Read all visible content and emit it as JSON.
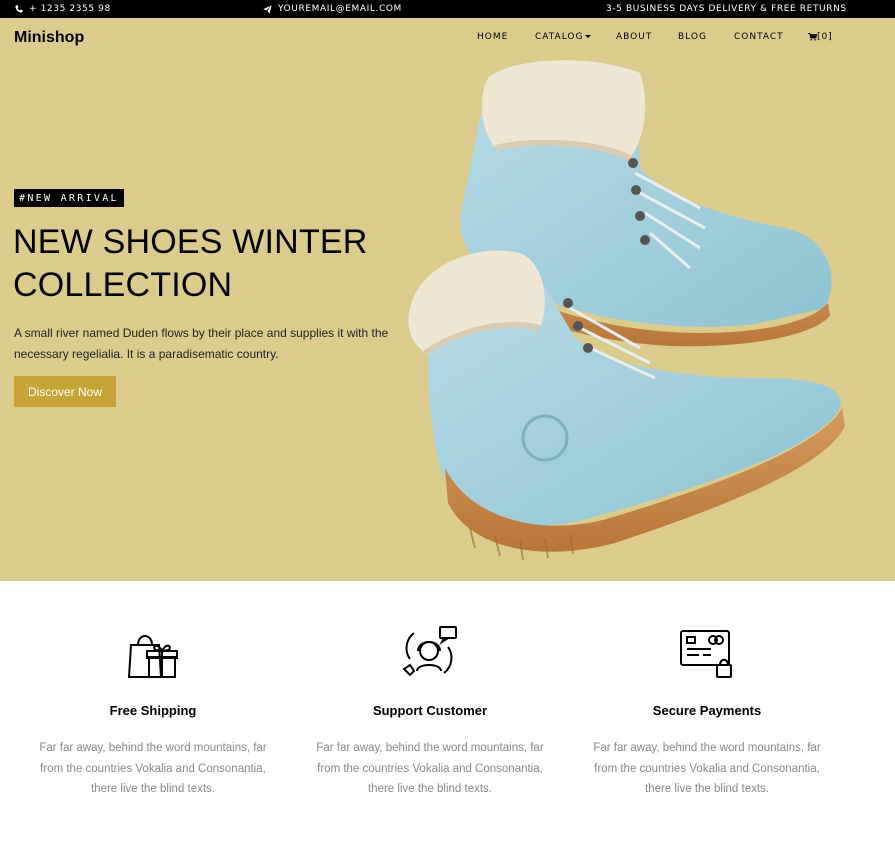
{
  "topbar": {
    "phone": "+ 1235 2355 98",
    "email": "YOUREMAIL@EMAIL.COM",
    "delivery": "3-5 BUSINESS DAYS DELIVERY & FREE RETURNS",
    "phone_icon": "phone-icon",
    "email_icon": "paper-plane-icon"
  },
  "header": {
    "logo": "Minishop",
    "nav": {
      "home": "HOME",
      "catalog": "CATALOG",
      "about": "ABOUT",
      "blog": "BLOG",
      "contact": "CONTACT",
      "cart": "[0]"
    }
  },
  "hero": {
    "badge": "#NEW ARRIVAL",
    "title_line1": "NEW SHOES WINTER",
    "title_line2": "COLLECTION",
    "description": "A small river named Duden flows by their place and supplies it with the necessary regelialia. It is a paradisematic country.",
    "cta": "Discover Now",
    "image": "blue-winter-boots",
    "bg_color": "#dbcc8d",
    "accent_color": "#c6a536"
  },
  "features": [
    {
      "icon": "shopping-bag-gift-icon",
      "title": "Free Shipping",
      "text": "Far far away, behind the word mountains, far from the countries Vokalia and Consonantia, there live the blind texts."
    },
    {
      "icon": "support-agent-icon",
      "title": "Support Customer",
      "text": "Far far away, behind the word mountains, far from the countries Vokalia and Consonantia, there live the blind texts."
    },
    {
      "icon": "credit-card-lock-icon",
      "title": "Secure Payments",
      "text": "Far far away, behind the word mountains, far from the countries Vokalia and Consonantia, there live the blind texts."
    }
  ]
}
